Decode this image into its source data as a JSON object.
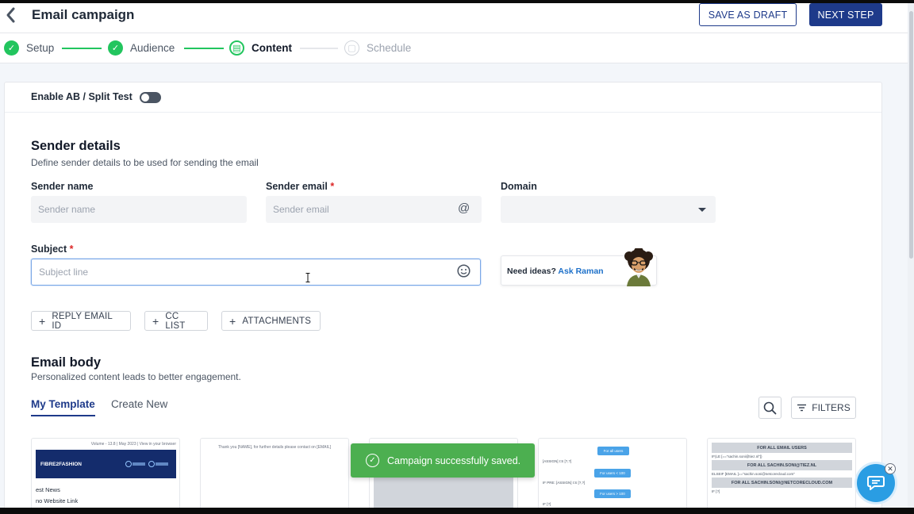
{
  "header": {
    "title": "Email campaign",
    "save_draft_label": "SAVE AS DRAFT",
    "next_step_label": "NEXT STEP"
  },
  "stepper": {
    "steps": [
      {
        "label": "Setup",
        "state": "done"
      },
      {
        "label": "Audience",
        "state": "done"
      },
      {
        "label": "Content",
        "state": "active"
      },
      {
        "label": "Schedule",
        "state": "todo"
      }
    ]
  },
  "ab_test": {
    "label": "Enable AB / Split Test",
    "enabled": false
  },
  "sender": {
    "title": "Sender details",
    "subtitle": "Define sender details to be used for sending the email",
    "name_label": "Sender name",
    "name_placeholder": "Sender name",
    "email_label": "Sender email",
    "email_placeholder": "Sender email",
    "domain_label": "Domain",
    "domain_value": "",
    "subject_label": "Subject",
    "subject_placeholder": "Subject line",
    "required_mark": "*"
  },
  "ideas": {
    "prefix": "Need ideas?",
    "link": "Ask Raman"
  },
  "chips": [
    {
      "label": "REPLY EMAIL ID"
    },
    {
      "label": "CC LIST"
    },
    {
      "label": "ATTACHMENTS"
    }
  ],
  "body": {
    "title": "Email body",
    "subtitle": "Personalized content leads to better engagement.",
    "tabs": [
      {
        "label": "My Template",
        "active": true
      },
      {
        "label": "Create New",
        "active": false
      }
    ],
    "filters_label": "FILTERS"
  },
  "templates": {
    "t1": {
      "top_text": "Volume - 13.8 | May 2023 | View in your browser",
      "brand": "FIBRE2FASHION",
      "line1": "est News",
      "line2": "no Website Link"
    },
    "t2": {
      "text": "Thank you [NAME], for further details please contact on [EMAIL]"
    },
    "t4": {
      "btn1": "For all users",
      "btn2": "For users < 100",
      "btn3": "For users > 100",
      "txt1": "[ASSIGN] I:S [?,?]",
      "txt2": "IF PRE: [ASSIGN] I:S [?,?]",
      "txt3": "IF [?]"
    },
    "t5": {
      "bar1": "FOR ALL EMAIL USERS",
      "bar2": "FOR ALL SACHIN.SONI@TIEZ.NL",
      "bar3": "FOR ALL SACHIN.SONI@NETCORECLOUD.COM",
      "txt1": "IF(LE [==\"sachin.soni@tiez.nl\"])",
      "txt2": "ELSEIF [EMAIL ]==\"sachin.soni@netcorecloud.com\"",
      "txt3": "IF [?]"
    }
  },
  "toast": {
    "message": "Campaign successfully saved."
  },
  "colors": {
    "primary": "#1e3a8a",
    "success": "#22c55e",
    "toast": "#4caf50",
    "chat": "#2a9de3"
  }
}
